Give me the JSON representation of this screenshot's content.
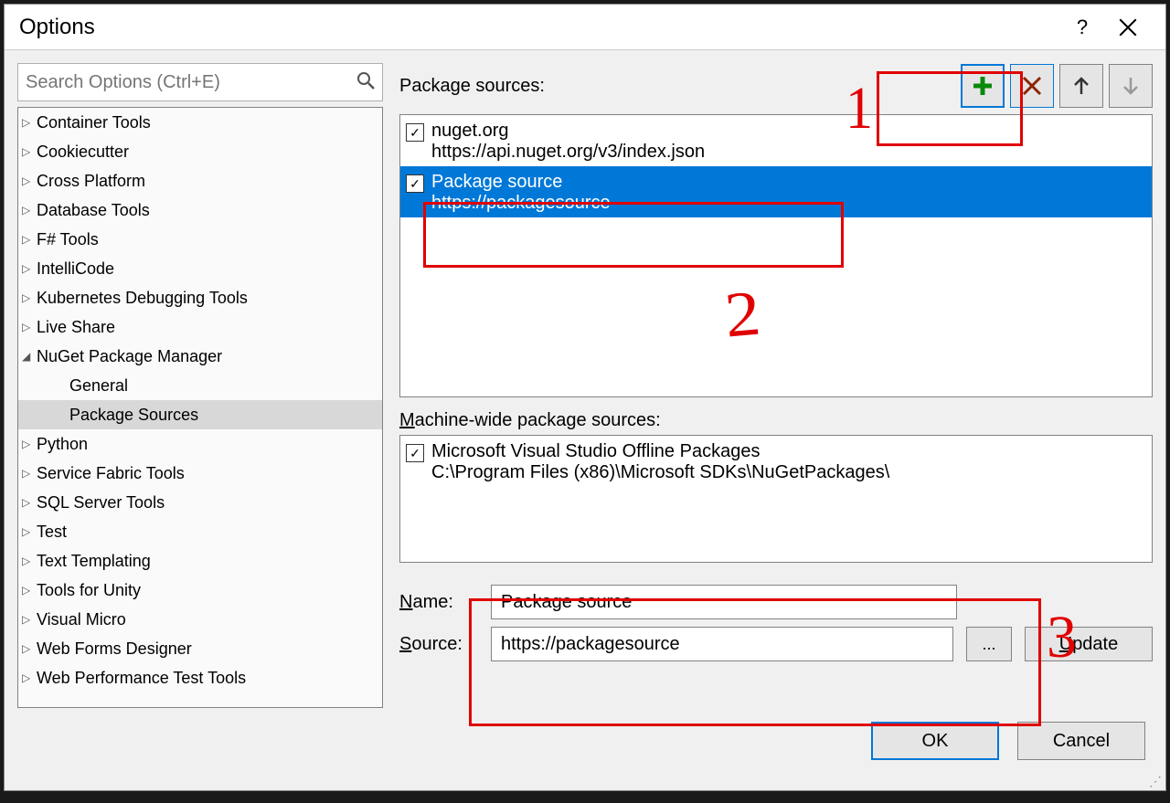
{
  "title": "Options",
  "search_placeholder": "Search Options (Ctrl+E)",
  "tree": {
    "items": [
      {
        "label": "Container Tools",
        "expanded": false,
        "child": false
      },
      {
        "label": "Cookiecutter",
        "expanded": false,
        "child": false
      },
      {
        "label": "Cross Platform",
        "expanded": false,
        "child": false
      },
      {
        "label": "Database Tools",
        "expanded": false,
        "child": false
      },
      {
        "label": "F# Tools",
        "expanded": false,
        "child": false
      },
      {
        "label": "IntelliCode",
        "expanded": false,
        "child": false
      },
      {
        "label": "Kubernetes Debugging Tools",
        "expanded": false,
        "child": false
      },
      {
        "label": "Live Share",
        "expanded": false,
        "child": false
      },
      {
        "label": "NuGet Package Manager",
        "expanded": true,
        "child": false
      },
      {
        "label": "General",
        "expanded": null,
        "child": true
      },
      {
        "label": "Package Sources",
        "expanded": null,
        "child": true,
        "selected": true
      },
      {
        "label": "Python",
        "expanded": false,
        "child": false
      },
      {
        "label": "Service Fabric Tools",
        "expanded": false,
        "child": false
      },
      {
        "label": "SQL Server Tools",
        "expanded": false,
        "child": false
      },
      {
        "label": "Test",
        "expanded": false,
        "child": false
      },
      {
        "label": "Text Templating",
        "expanded": false,
        "child": false
      },
      {
        "label": "Tools for Unity",
        "expanded": false,
        "child": false
      },
      {
        "label": "Visual Micro",
        "expanded": false,
        "child": false
      },
      {
        "label": "Web Forms Designer",
        "expanded": false,
        "child": false
      },
      {
        "label": "Web Performance Test Tools",
        "expanded": false,
        "child": false
      }
    ]
  },
  "labels": {
    "package_sources": "Package sources:",
    "machine_sources": "achine-wide package sources:",
    "machine_sources_prefix": "M",
    "name": "ame:",
    "name_prefix": "N",
    "source": "ource:",
    "source_prefix": "S",
    "browse": "...",
    "update": "pdate",
    "update_prefix": "U",
    "ok": "OK",
    "cancel": "Cancel",
    "help": "?"
  },
  "sources": [
    {
      "name": "nuget.org",
      "url": "https://api.nuget.org/v3/index.json",
      "checked": true,
      "selected": false
    },
    {
      "name": "Package source",
      "url": "https://packagesource",
      "checked": true,
      "selected": true
    }
  ],
  "machine_sources": [
    {
      "name": "Microsoft Visual Studio Offline Packages",
      "url": "C:\\Program Files (x86)\\Microsoft SDKs\\NuGetPackages\\",
      "checked": true
    }
  ],
  "form": {
    "name": "Package source",
    "source": "https://packagesource"
  },
  "annotations": {
    "n1": "1",
    "n2": "2",
    "n3": "3"
  }
}
